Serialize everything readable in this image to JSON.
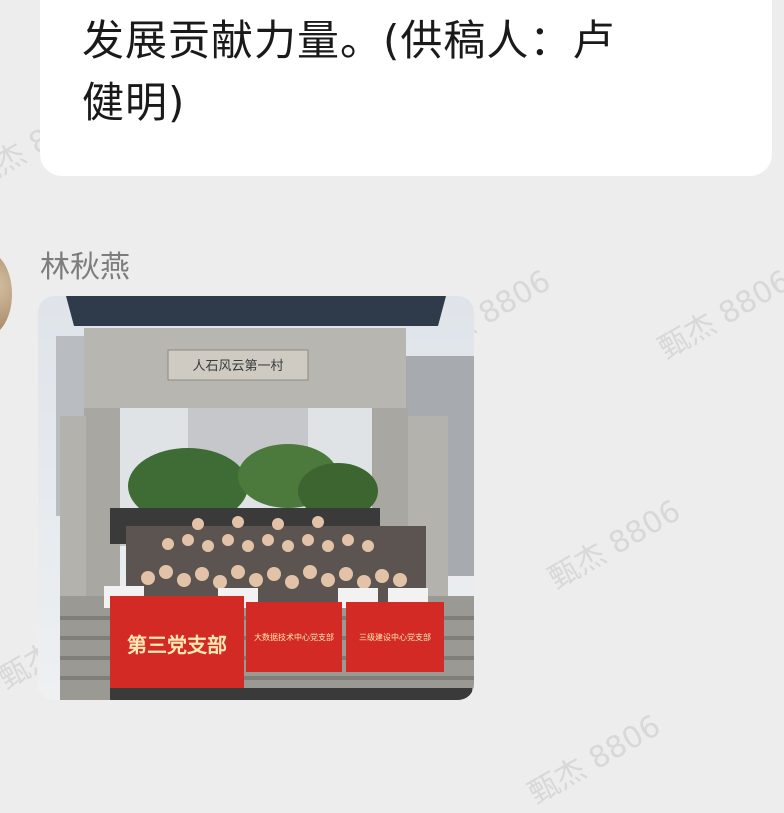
{
  "message_text": {
    "line1": "发展贡献力量。(供稿人：卢",
    "line2": "健明)"
  },
  "sender_name": "林秋燕",
  "photo": {
    "gate_plaque": "人石风云第一村",
    "banners": [
      "第三党支部",
      "大数据技术中心党支部",
      "三级建设中心党支部"
    ]
  },
  "watermark": {
    "text": "甄杰 8806"
  },
  "colors": {
    "background": "#ededed",
    "bubble": "#ffffff",
    "banner_red": "#d42a26"
  }
}
